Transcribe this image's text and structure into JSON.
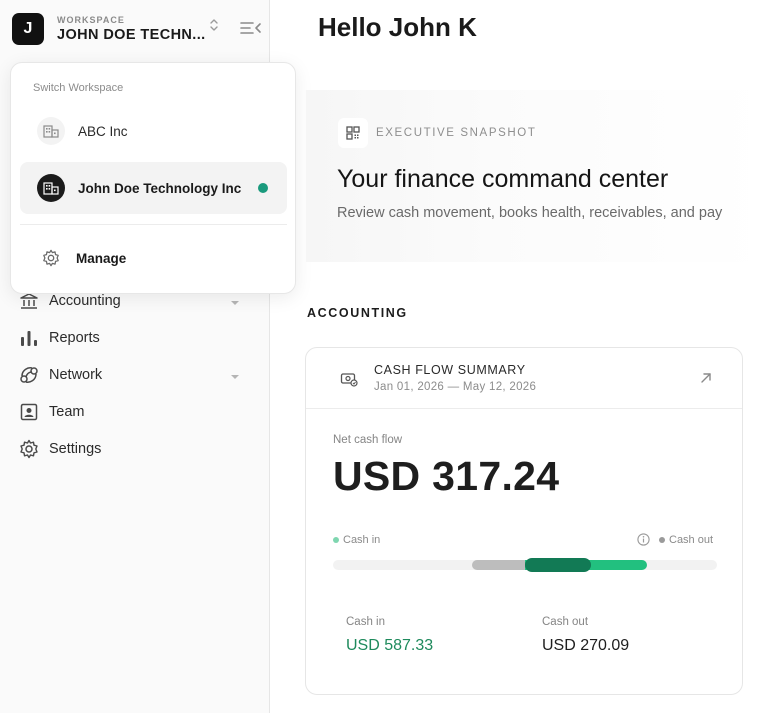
{
  "workspace": {
    "caption": "WORKSPACE",
    "initial": "J",
    "name": "JOHN DOE TECHN..."
  },
  "switcher": {
    "caption": "Switch Workspace",
    "items": [
      {
        "label": "ABC Inc",
        "active": false
      },
      {
        "label": "John Doe Technology Inc",
        "active": true
      }
    ],
    "manage_label": "Manage"
  },
  "nav": {
    "items": [
      {
        "label": "Accounting",
        "icon": "bank-icon",
        "expandable": true
      },
      {
        "label": "Reports",
        "icon": "bar-chart-icon",
        "expandable": false
      },
      {
        "label": "Network",
        "icon": "network-icon",
        "expandable": true
      },
      {
        "label": "Team",
        "icon": "person-card-icon",
        "expandable": false
      },
      {
        "label": "Settings",
        "icon": "gear-icon",
        "expandable": false
      }
    ]
  },
  "main": {
    "greeting": "Hello John K",
    "snapshot": {
      "caption": "EXECUTIVE SNAPSHOT",
      "title": "Your finance command center",
      "description": "Review cash movement, books health, receivables, and pay"
    },
    "section_title": "ACCOUNTING",
    "cash_flow": {
      "title": "CASH FLOW SUMMARY",
      "date_range": "Jan 01, 2026 — May 12, 2026",
      "net_label": "Net cash flow",
      "net_value": "USD 317.24",
      "legend_in": "Cash in",
      "legend_out": "Cash out",
      "cash_in_label": "Cash in",
      "cash_in_value": "USD 587.33",
      "cash_out_label": "Cash out",
      "cash_out_value": "USD 270.09",
      "cash_in_amount": 587.33,
      "cash_out_amount": 270.09
    }
  },
  "colors": {
    "accent_green": "#1a9a7d",
    "cash_in_green": "#1e8a5c",
    "bar_green": "#22c07f",
    "bar_dark_green": "#127a55",
    "bar_grey": "#bdbdbd"
  }
}
